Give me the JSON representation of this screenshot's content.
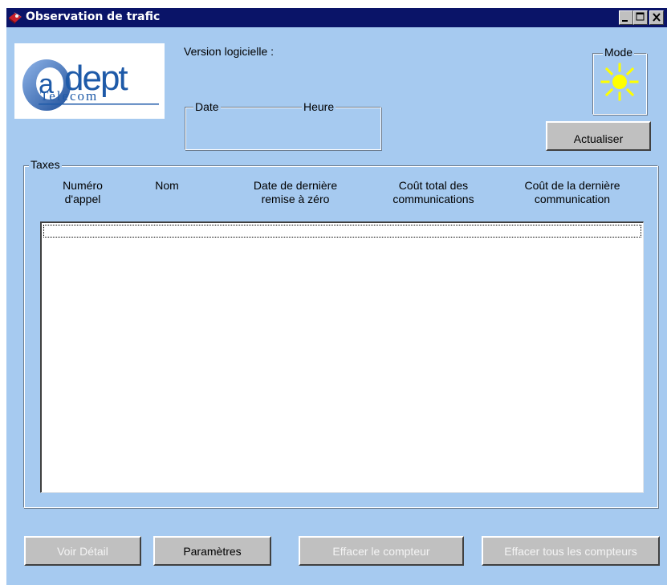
{
  "window": {
    "title": "Observation de trafic"
  },
  "logo": {
    "brand": "adept",
    "subtitle": "Telecom",
    "accent_color": "#1e5aa8"
  },
  "header": {
    "version_label": "Version logicielle :",
    "date_label": "Date",
    "time_label": "Heure",
    "mode_label": "Mode",
    "mode_icon": "sun-icon",
    "mode_color": "#ffff00",
    "refresh_label": "Actualiser"
  },
  "taxes": {
    "group_label": "Taxes",
    "columns": [
      {
        "line1": "Numéro",
        "line2": "d'appel"
      },
      {
        "line1": "Nom",
        "line2": ""
      },
      {
        "line1": "Date de dernière",
        "line2": "remise à zéro"
      },
      {
        "line1": "Coût total des",
        "line2": "communications"
      },
      {
        "line1": "Coût de la dernière",
        "line2": "communication"
      }
    ],
    "rows": []
  },
  "buttons": {
    "detail": "Voir Détail",
    "params": "Paramètres",
    "clear": "Effacer le compteur",
    "clear_all": "Effacer tous les compteurs"
  }
}
